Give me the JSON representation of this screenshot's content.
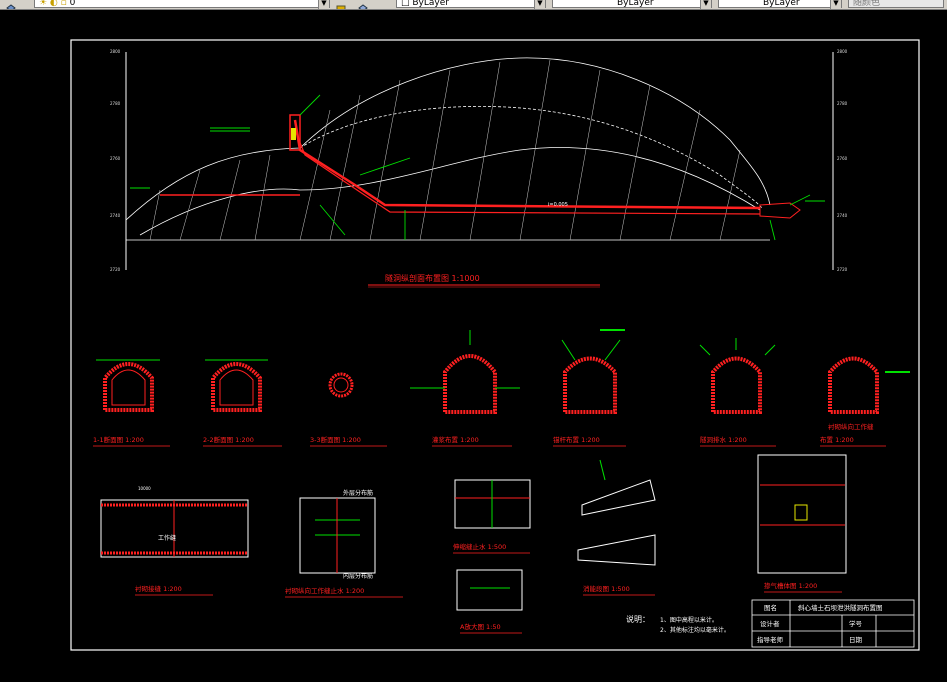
{
  "toolbar": {
    "layer_value": "0",
    "color_value": "ByLayer",
    "linetype_value": "ByLayer",
    "lineweight_value": "ByLayer",
    "plotstyle_value": "随颜色"
  },
  "drawing": {
    "main_section_title": "隧洞纵剖面布置图 1:1000",
    "slope_label": "i=0.005",
    "elev_ticks": [
      "2800",
      "2780",
      "2760",
      "2740",
      "2720"
    ],
    "section_titles": [
      "1-1断面图 1:200",
      "2-2断面图 1:200",
      "3-3断面图 1:200",
      "灌浆布置 1:200",
      "锚杆布置 1:200",
      "隧洞排水 1:200",
      "衬砌纵向工作缝",
      "布置 1:200"
    ],
    "bottom_titles": [
      "衬砌接缝 1:200",
      "衬砌纵向工作缝止水 1:200",
      "伸缩缝止水 1:500",
      "A放大图 1:50",
      "消能段图 1:500",
      "掺气槽体图 1:200"
    ],
    "inner_labels": [
      "工作缝",
      "外层分布筋",
      "内层分布筋"
    ],
    "dim_label": "10000",
    "notes_title": "说明：",
    "notes": [
      "1、图中高程以米计。",
      "2、其他标注均以毫米计。"
    ],
    "title_block": {
      "name_label": "图名",
      "drawing_name": "斜心墙土石坝泄洪隧洞布置图",
      "designer_label": "设计者",
      "student_id_label": "学号",
      "advisor_label": "指导老师",
      "date_label": "日期"
    }
  }
}
